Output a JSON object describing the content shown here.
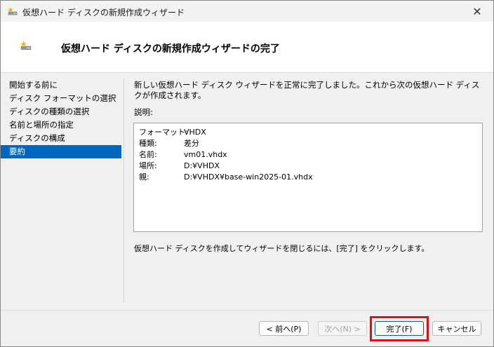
{
  "window": {
    "title": "仮想ハード ディスクの新規作成ウィザード",
    "close_glyph": "✕"
  },
  "header": {
    "title": "仮想ハード ディスクの新規作成ウィザードの完了"
  },
  "sidebar": {
    "items": [
      {
        "label": "開始する前に"
      },
      {
        "label": "ディスク フォーマットの選択"
      },
      {
        "label": "ディスクの種類の選択"
      },
      {
        "label": "名前と場所の指定"
      },
      {
        "label": "ディスクの構成"
      },
      {
        "label": "要約"
      }
    ],
    "active_index": 5
  },
  "main": {
    "intro": "新しい仮想ハード ディスク ウィザードを正常に完了しました。これから次の仮想ハード ディスクが作成されます。",
    "description_label": "説明:",
    "summary": [
      {
        "key": "フォーマット:",
        "value": "VHDX"
      },
      {
        "key": "種類:",
        "value": "差分"
      },
      {
        "key": "名前:",
        "value": "vm01.vhdx"
      },
      {
        "key": "場所:",
        "value": "D:¥VHDX"
      },
      {
        "key": "親:",
        "value": "D:¥VHDX¥base-win2025-01.vhdx"
      }
    ],
    "footer_note": "仮想ハード ディスクを作成してウィザードを閉じるには、[完了] をクリックします。"
  },
  "buttons": {
    "back": "< 前へ(P)",
    "next": "次へ(N) >",
    "finish": "完了(F)",
    "cancel": "キャンセル"
  },
  "colors": {
    "accent": "#0067c0",
    "highlight": "#e01010"
  }
}
